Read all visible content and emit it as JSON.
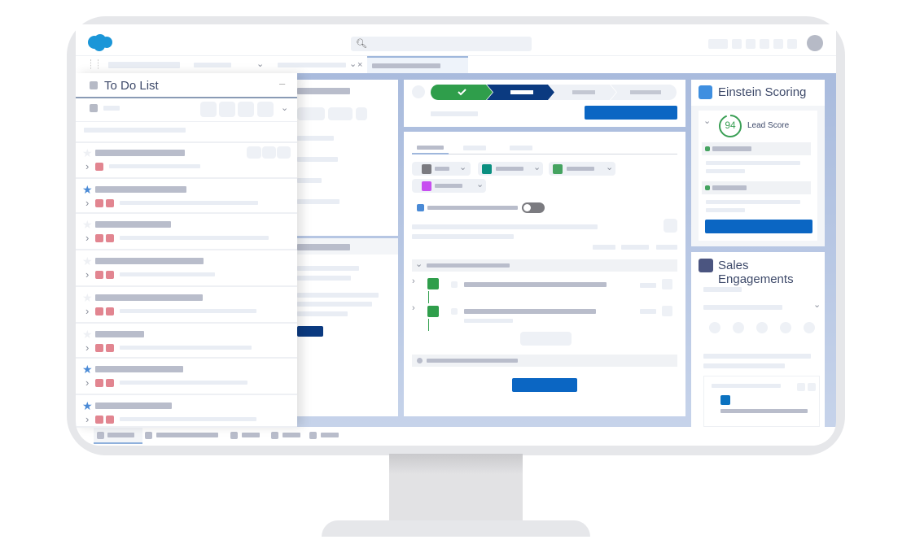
{
  "colors": {
    "brand": "#1b96d8",
    "primary_button": "#0b66c3",
    "path_complete": "#2f9e4b",
    "path_current": "#0b3a80",
    "star_active": "#4a8ad6",
    "tag": "#e28590",
    "score_ring": "#3a9f55"
  },
  "todo_panel": {
    "title": "To Do List",
    "minimize_icon": "minus-icon",
    "items": [
      {
        "starred": false,
        "tags": 1
      },
      {
        "starred": true,
        "tags": 2
      },
      {
        "starred": false,
        "tags": 2
      },
      {
        "starred": false,
        "tags": 2
      },
      {
        "starred": false,
        "tags": 2
      },
      {
        "starred": false,
        "tags": 2
      },
      {
        "starred": true,
        "tags": 2
      },
      {
        "starred": true,
        "tags": 2
      }
    ]
  },
  "path": {
    "steps": [
      "complete",
      "current",
      "upcoming",
      "upcoming"
    ]
  },
  "einstein": {
    "title": "Einstein Scoring",
    "score": "94",
    "score_label": "Lead Score",
    "score_fraction": 0.94
  },
  "sales_engagements": {
    "title": "Sales Engagements"
  },
  "toggle": {
    "on": false
  }
}
